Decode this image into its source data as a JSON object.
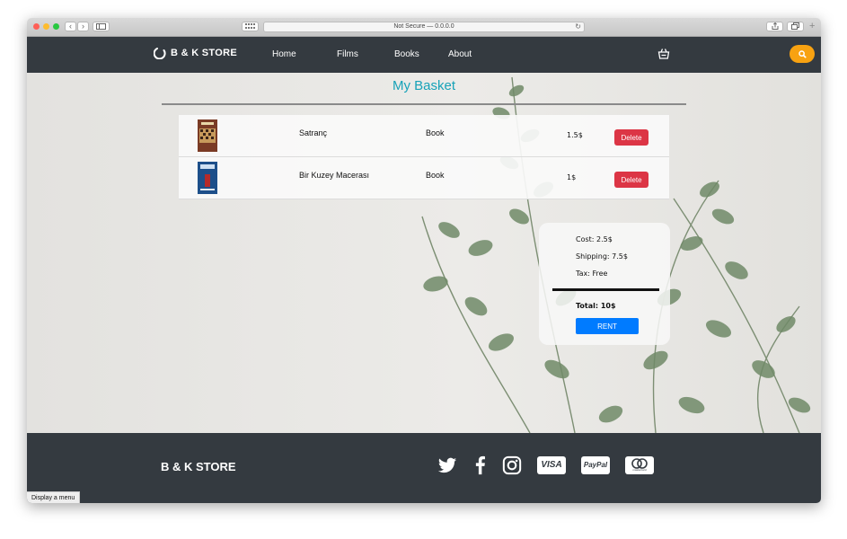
{
  "browser": {
    "address": "Not Secure — 0.0.0.0",
    "back": "‹",
    "forward": "›",
    "reload": "↻"
  },
  "nav": {
    "brand": "B & K STORE",
    "links": [
      "Home",
      "Films",
      "Books",
      "About"
    ]
  },
  "basket": {
    "title": "My Basket",
    "items": [
      {
        "title": "Satranç",
        "type": "Book",
        "price": "1.5$",
        "action": "Delete",
        "cover_color": "#7a3b25"
      },
      {
        "title": "Bir Kuzey Macerası",
        "type": "Book",
        "price": "1$",
        "action": "Delete",
        "cover_color": "#1d4f8a"
      }
    ]
  },
  "summary": {
    "cost": "Cost: 2.5$",
    "shipping": "Shipping: 7.5$",
    "tax": "Tax: Free",
    "total": "Total: 10$",
    "rent_label": "RENT"
  },
  "footer": {
    "brand": "B & K STORE",
    "payments": [
      "VISA",
      "PayPal",
      "mastercard"
    ]
  },
  "status": {
    "tooltip": "Display a menu"
  },
  "colors": {
    "navbar": "#343a40",
    "accent_title": "#17a2b8",
    "delete": "#dc3545",
    "rent": "#007bff",
    "search": "#f8a211"
  }
}
